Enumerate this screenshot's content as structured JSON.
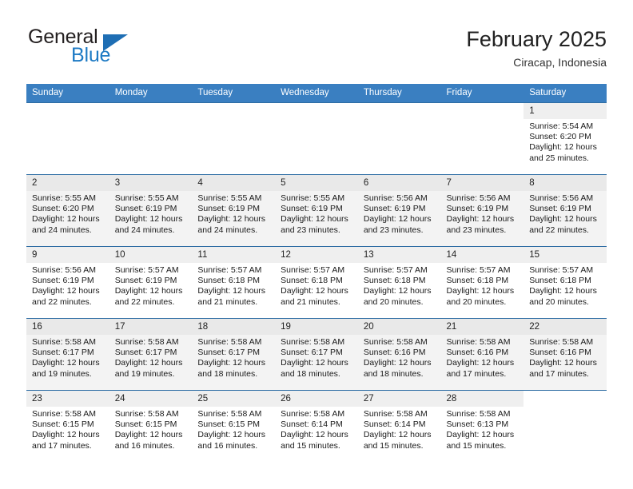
{
  "brand": {
    "name_top": "General",
    "name_bottom": "Blue",
    "triangle_color": "#1e6eb4",
    "text_color": "#231f20",
    "blue_color": "#1d7ac4"
  },
  "header": {
    "title": "February 2025",
    "subtitle": "Ciracap, Indonesia",
    "header_bg": "#3a7fc1",
    "row_border": "#2e6da4"
  },
  "calendar": {
    "weekday_headers": [
      "Sunday",
      "Monday",
      "Tuesday",
      "Wednesday",
      "Thursday",
      "Friday",
      "Saturday"
    ],
    "labels": {
      "sunrise": "Sunrise:",
      "sunset": "Sunset:",
      "daylight": "Daylight:"
    },
    "weeks": [
      [
        {
          "day": "",
          "sunrise": "",
          "sunset": "",
          "daylight_1": "",
          "daylight_2": ""
        },
        {
          "day": "",
          "sunrise": "",
          "sunset": "",
          "daylight_1": "",
          "daylight_2": ""
        },
        {
          "day": "",
          "sunrise": "",
          "sunset": "",
          "daylight_1": "",
          "daylight_2": ""
        },
        {
          "day": "",
          "sunrise": "",
          "sunset": "",
          "daylight_1": "",
          "daylight_2": ""
        },
        {
          "day": "",
          "sunrise": "",
          "sunset": "",
          "daylight_1": "",
          "daylight_2": ""
        },
        {
          "day": "",
          "sunrise": "",
          "sunset": "",
          "daylight_1": "",
          "daylight_2": ""
        },
        {
          "day": "1",
          "sunrise": "Sunrise: 5:54 AM",
          "sunset": "Sunset: 6:20 PM",
          "daylight_1": "Daylight: 12 hours",
          "daylight_2": "and 25 minutes."
        }
      ],
      [
        {
          "day": "2",
          "sunrise": "Sunrise: 5:55 AM",
          "sunset": "Sunset: 6:20 PM",
          "daylight_1": "Daylight: 12 hours",
          "daylight_2": "and 24 minutes."
        },
        {
          "day": "3",
          "sunrise": "Sunrise: 5:55 AM",
          "sunset": "Sunset: 6:19 PM",
          "daylight_1": "Daylight: 12 hours",
          "daylight_2": "and 24 minutes."
        },
        {
          "day": "4",
          "sunrise": "Sunrise: 5:55 AM",
          "sunset": "Sunset: 6:19 PM",
          "daylight_1": "Daylight: 12 hours",
          "daylight_2": "and 24 minutes."
        },
        {
          "day": "5",
          "sunrise": "Sunrise: 5:55 AM",
          "sunset": "Sunset: 6:19 PM",
          "daylight_1": "Daylight: 12 hours",
          "daylight_2": "and 23 minutes."
        },
        {
          "day": "6",
          "sunrise": "Sunrise: 5:56 AM",
          "sunset": "Sunset: 6:19 PM",
          "daylight_1": "Daylight: 12 hours",
          "daylight_2": "and 23 minutes."
        },
        {
          "day": "7",
          "sunrise": "Sunrise: 5:56 AM",
          "sunset": "Sunset: 6:19 PM",
          "daylight_1": "Daylight: 12 hours",
          "daylight_2": "and 23 minutes."
        },
        {
          "day": "8",
          "sunrise": "Sunrise: 5:56 AM",
          "sunset": "Sunset: 6:19 PM",
          "daylight_1": "Daylight: 12 hours",
          "daylight_2": "and 22 minutes."
        }
      ],
      [
        {
          "day": "9",
          "sunrise": "Sunrise: 5:56 AM",
          "sunset": "Sunset: 6:19 PM",
          "daylight_1": "Daylight: 12 hours",
          "daylight_2": "and 22 minutes."
        },
        {
          "day": "10",
          "sunrise": "Sunrise: 5:57 AM",
          "sunset": "Sunset: 6:19 PM",
          "daylight_1": "Daylight: 12 hours",
          "daylight_2": "and 22 minutes."
        },
        {
          "day": "11",
          "sunrise": "Sunrise: 5:57 AM",
          "sunset": "Sunset: 6:18 PM",
          "daylight_1": "Daylight: 12 hours",
          "daylight_2": "and 21 minutes."
        },
        {
          "day": "12",
          "sunrise": "Sunrise: 5:57 AM",
          "sunset": "Sunset: 6:18 PM",
          "daylight_1": "Daylight: 12 hours",
          "daylight_2": "and 21 minutes."
        },
        {
          "day": "13",
          "sunrise": "Sunrise: 5:57 AM",
          "sunset": "Sunset: 6:18 PM",
          "daylight_1": "Daylight: 12 hours",
          "daylight_2": "and 20 minutes."
        },
        {
          "day": "14",
          "sunrise": "Sunrise: 5:57 AM",
          "sunset": "Sunset: 6:18 PM",
          "daylight_1": "Daylight: 12 hours",
          "daylight_2": "and 20 minutes."
        },
        {
          "day": "15",
          "sunrise": "Sunrise: 5:57 AM",
          "sunset": "Sunset: 6:18 PM",
          "daylight_1": "Daylight: 12 hours",
          "daylight_2": "and 20 minutes."
        }
      ],
      [
        {
          "day": "16",
          "sunrise": "Sunrise: 5:58 AM",
          "sunset": "Sunset: 6:17 PM",
          "daylight_1": "Daylight: 12 hours",
          "daylight_2": "and 19 minutes."
        },
        {
          "day": "17",
          "sunrise": "Sunrise: 5:58 AM",
          "sunset": "Sunset: 6:17 PM",
          "daylight_1": "Daylight: 12 hours",
          "daylight_2": "and 19 minutes."
        },
        {
          "day": "18",
          "sunrise": "Sunrise: 5:58 AM",
          "sunset": "Sunset: 6:17 PM",
          "daylight_1": "Daylight: 12 hours",
          "daylight_2": "and 18 minutes."
        },
        {
          "day": "19",
          "sunrise": "Sunrise: 5:58 AM",
          "sunset": "Sunset: 6:17 PM",
          "daylight_1": "Daylight: 12 hours",
          "daylight_2": "and 18 minutes."
        },
        {
          "day": "20",
          "sunrise": "Sunrise: 5:58 AM",
          "sunset": "Sunset: 6:16 PM",
          "daylight_1": "Daylight: 12 hours",
          "daylight_2": "and 18 minutes."
        },
        {
          "day": "21",
          "sunrise": "Sunrise: 5:58 AM",
          "sunset": "Sunset: 6:16 PM",
          "daylight_1": "Daylight: 12 hours",
          "daylight_2": "and 17 minutes."
        },
        {
          "day": "22",
          "sunrise": "Sunrise: 5:58 AM",
          "sunset": "Sunset: 6:16 PM",
          "daylight_1": "Daylight: 12 hours",
          "daylight_2": "and 17 minutes."
        }
      ],
      [
        {
          "day": "23",
          "sunrise": "Sunrise: 5:58 AM",
          "sunset": "Sunset: 6:15 PM",
          "daylight_1": "Daylight: 12 hours",
          "daylight_2": "and 17 minutes."
        },
        {
          "day": "24",
          "sunrise": "Sunrise: 5:58 AM",
          "sunset": "Sunset: 6:15 PM",
          "daylight_1": "Daylight: 12 hours",
          "daylight_2": "and 16 minutes."
        },
        {
          "day": "25",
          "sunrise": "Sunrise: 5:58 AM",
          "sunset": "Sunset: 6:15 PM",
          "daylight_1": "Daylight: 12 hours",
          "daylight_2": "and 16 minutes."
        },
        {
          "day": "26",
          "sunrise": "Sunrise: 5:58 AM",
          "sunset": "Sunset: 6:14 PM",
          "daylight_1": "Daylight: 12 hours",
          "daylight_2": "and 15 minutes."
        },
        {
          "day": "27",
          "sunrise": "Sunrise: 5:58 AM",
          "sunset": "Sunset: 6:14 PM",
          "daylight_1": "Daylight: 12 hours",
          "daylight_2": "and 15 minutes."
        },
        {
          "day": "28",
          "sunrise": "Sunrise: 5:58 AM",
          "sunset": "Sunset: 6:13 PM",
          "daylight_1": "Daylight: 12 hours",
          "daylight_2": "and 15 minutes."
        },
        {
          "day": "",
          "sunrise": "",
          "sunset": "",
          "daylight_1": "",
          "daylight_2": ""
        }
      ]
    ]
  }
}
